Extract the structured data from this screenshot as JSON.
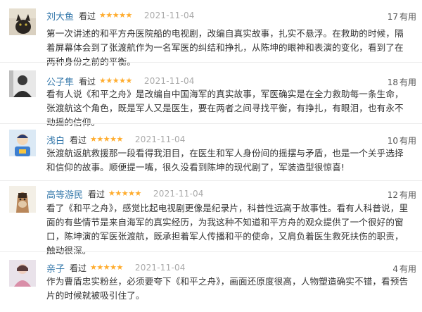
{
  "useful_label": "有用",
  "watched_label": "看过",
  "star_icon": "★",
  "colors": {
    "username": "#3377aa",
    "star": "#ffac2d",
    "date": "#aaaaaa",
    "text": "#333333"
  },
  "reviews": [
    {
      "username": "刘大鱼",
      "status": "看过",
      "rating": 5,
      "date": "2021-11-04",
      "useful_count": "17",
      "avatar": "cat-photo-avatar",
      "comment": "第一次讲述的和平方舟医院船的电视剧，改编自真实故事，扎实不悬浮。在救助的时候，隔着屏幕体会到了张渡航作为一名军医的纠结和挣扎，从陈坤的眼神和表演的变化，看到了在两种身份之前的平衡。"
    },
    {
      "username": "公子隼",
      "status": "看过",
      "rating": 5,
      "date": "2021-11-04",
      "useful_count": "18",
      "avatar": "portrait-bw-avatar",
      "comment": "看有人说《和平之舟》是改编自中国海军的真实故事，军医确实是在全力救助每一条生命，张渡航这个角色，既是军人又是医生，要在两者之间寻找平衡，有挣扎，有眼泪，也有永不动摇的信仰。"
    },
    {
      "username": "浅白",
      "status": "看过",
      "rating": 5,
      "date": "2021-11-04",
      "useful_count": "10",
      "avatar": "blue-cartoon-avatar",
      "comment": "张渡航返航救援那一段看得我泪目，在医生和军人身份间的摇摆与矛盾，也是一个关乎选择和信仰的故事。顺便提一嘴，很久没看到陈坤的现代剧了，军装造型很惊喜!"
    },
    {
      "username": "高等游民",
      "status": "看过",
      "rating": 5,
      "date": "2021-11-04",
      "useful_count": "12",
      "avatar": "horse-cartoon-avatar",
      "comment": "看了《和平之舟》，感觉比起电视剧更像是纪录片，科普性远高于故事性。看有人科普说，里面的有些情节是来自海军的真实经历，为我这种不知道和平方舟的观众提供了一个很好的窗口，陈坤演的军医张渡航，既承担着军人传播和平的使命，又肩负着医生救死扶伤的职责，触动很深。"
    },
    {
      "username": "亲子",
      "status": "看过",
      "rating": 5,
      "date": "2021-11-04",
      "useful_count": "4",
      "avatar": "pink-figure-avatar",
      "comment": "作为曹盾忠实粉丝，必须要夸下《和平之舟》，画面还原度很高，人物塑造确实不错，看预告片的时候就被吸引住了。"
    }
  ]
}
